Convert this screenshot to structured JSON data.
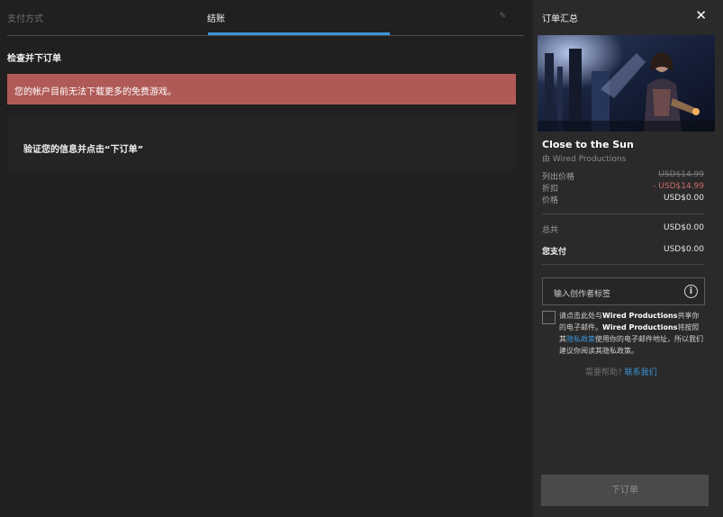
{
  "tabs": {
    "payment": "支付方式",
    "checkout": "结账"
  },
  "main": {
    "section_title": "检查并下订单",
    "alert": "您的帐户目前无法下载更多的免费游戏。",
    "verify": "验证您的信息并点击“下订单”"
  },
  "summary": {
    "title": "订单汇总",
    "close": "✕",
    "game_name": "Close to the Sun",
    "publisher": "由 Wired Productions",
    "list_price_label": "列出价格",
    "list_price": "USD$14.99",
    "discount_label": "折扣",
    "discount": "- USD$14.99",
    "price_label": "价格",
    "price": "USD$0.00",
    "total_label": "总共",
    "total": "USD$0.00",
    "pay_label": "您支付",
    "pay": "USD$0.00",
    "creator_placeholder": "输入创作者标签",
    "consent_1": "请点击此处与",
    "consent_brand_1": "Wired Productions",
    "consent_2": "共享你的电子邮件。",
    "consent_brand_2": "Wired Productions",
    "consent_3": "将按照其",
    "consent_privacy": "隐私政策",
    "consent_4": "使用你的电子邮件地址，所以我们建议你阅读其隐私政策。",
    "help_text": "需要帮助?",
    "help_link": "联系我们",
    "order_button": "下订单"
  },
  "colors": {
    "accent": "#3b96d8",
    "alert_bg": "#b05a57",
    "discount": "#d06a6a"
  }
}
